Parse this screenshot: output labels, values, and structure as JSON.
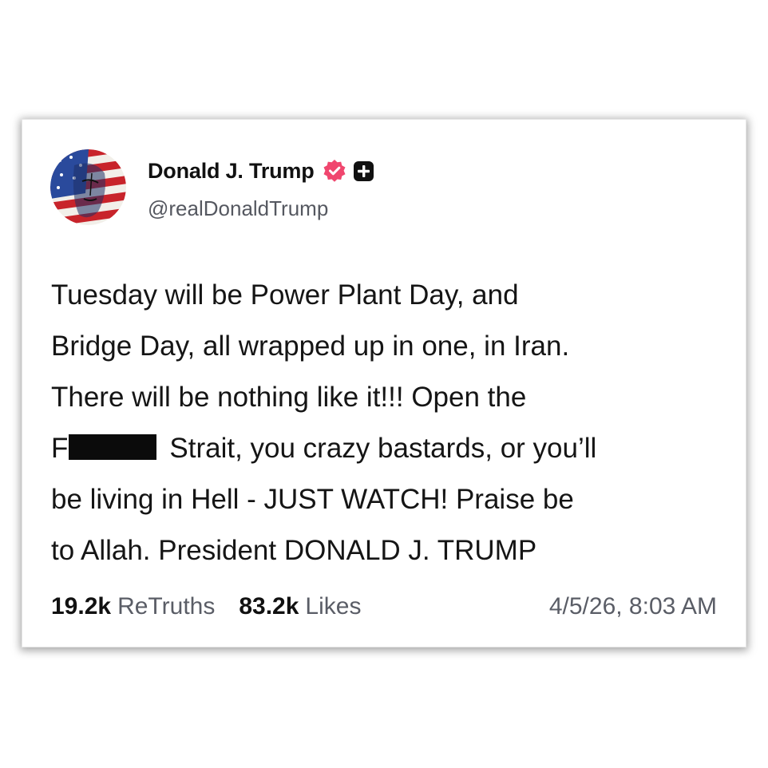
{
  "post": {
    "author_name": "Donald J. Trump",
    "author_handle": "@realDonaldTrump",
    "line1": "Tuesday will be Power Plant Day, and",
    "line2": "Bridge Day, all wrapped up in one, in Iran.",
    "line3": "There will be nothing like it!!! Open the",
    "line4_prefix": "F",
    "line4_suffix": "Strait, you crazy bastards, or you’ll",
    "line5": "be living in Hell - JUST WATCH! Praise be",
    "line6": "to Allah. President DONALD J. TRUMP",
    "retruths_count": "19.2k",
    "retruths_label": "ReTruths",
    "likes_count": "83.2k",
    "likes_label": "Likes",
    "timestamp": "4/5/26, 8:03 AM"
  },
  "icons": {
    "avatar": "flag-painted-portrait",
    "verified": "verified-badge-icon",
    "plus": "plus-badge-icon"
  },
  "colors": {
    "verified_badge": "#f0466e",
    "text_primary": "#111111",
    "text_secondary": "#5a5d66",
    "redaction": "#0b0b0b"
  }
}
